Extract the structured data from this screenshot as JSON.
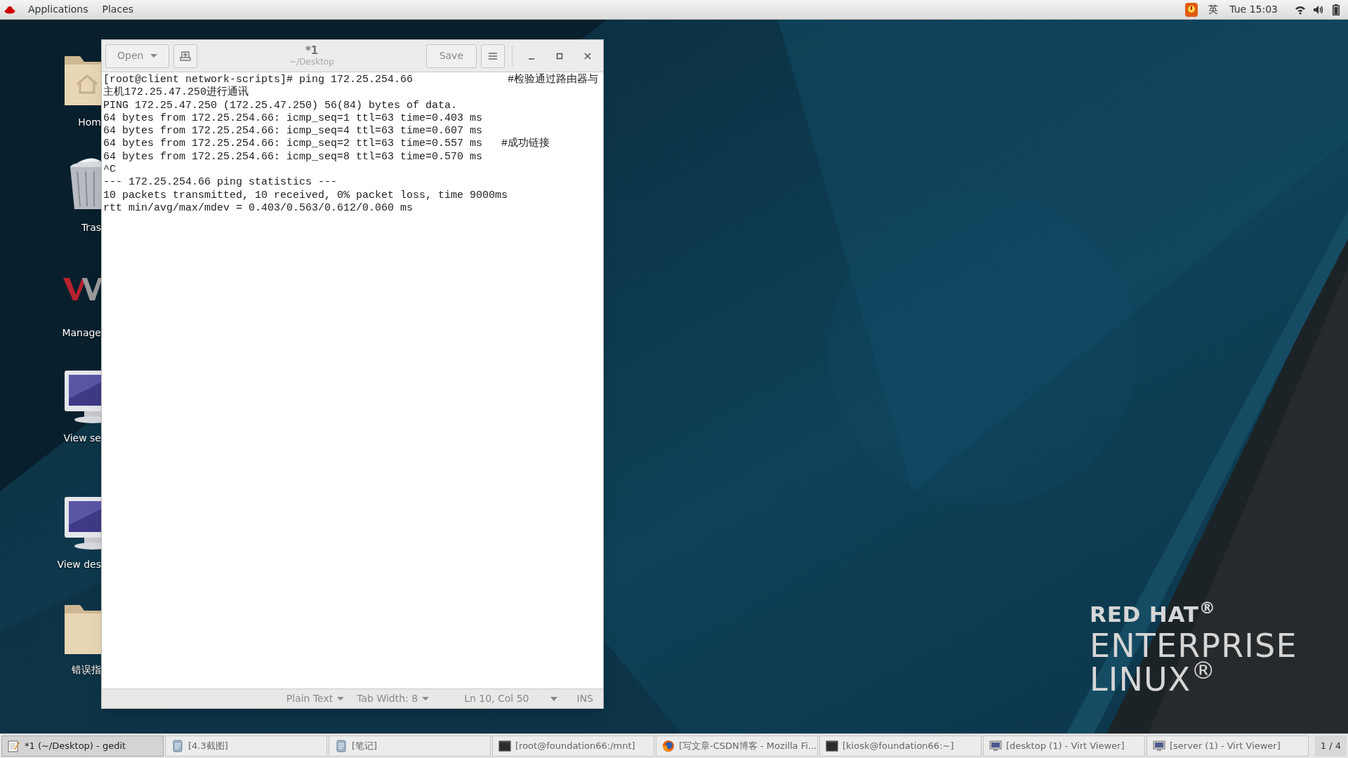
{
  "top_bar": {
    "menus": [
      "Applications",
      "Places"
    ],
    "input_method": "英",
    "clock": "Tue 15:03"
  },
  "desktop_icons": [
    {
      "label": "Hom",
      "kind": "home"
    },
    {
      "label": "Tras",
      "kind": "trash"
    },
    {
      "label": "Manage",
      "kind": "logo"
    },
    {
      "label": "View se",
      "kind": "monitor"
    },
    {
      "label": "View des",
      "kind": "monitor"
    },
    {
      "label": "错误指",
      "kind": "folder"
    }
  ],
  "wallpaper": {
    "logo": [
      "RED HAT$^{®}$",
      "ENTERPRISE",
      "LINUX$^{®}$"
    ]
  },
  "editor": {
    "title": "*1",
    "subtitle": "~/Desktop",
    "open_button": "Open",
    "save_button": "Save",
    "lines": [
      "[root@client network-scripts]# ping 172.25.254.66               #检验通过路由器与",
      "主机172.25.47.250进行通讯",
      "PING 172.25.47.250 (172.25.47.250) 56(84) bytes of data.",
      "64 bytes from 172.25.254.66: icmp_seq=1 ttl=63 time=0.403 ms",
      "64 bytes from 172.25.254.66: icmp_seq=4 ttl=63 time=0.607 ms",
      "64 bytes from 172.25.254.66: icmp_seq=2 ttl=63 time=0.557 ms   #成功链接",
      "64 bytes from 172.25.254.66: icmp_seq=8 ttl=63 time=0.570 ms",
      "^C",
      "--- 172.25.254.66 ping statistics ---",
      "10 packets transmitted, 10 received, 0% packet loss, time 9000ms",
      "rtt min/avg/max/mdev = 0.403/0.563/0.612/0.060 ms"
    ],
    "status": {
      "language": "Plain Text",
      "tab_width": "Tab Width: 8",
      "position": "Ln 10, Col 50",
      "mode": "INS"
    }
  },
  "taskbar": {
    "items": [
      {
        "label": "*1 (~/Desktop) - gedit",
        "kind": "editor",
        "selected": true
      },
      {
        "label": "[4.3截图]",
        "kind": "note",
        "selected": false
      },
      {
        "label": "[笔记]",
        "kind": "note",
        "selected": false
      },
      {
        "label": "[root@foundation66:/mnt]",
        "kind": "terminal",
        "selected": false
      },
      {
        "label": "[写文章-CSDN博客 - Mozilla Fi...",
        "kind": "browser",
        "selected": false
      },
      {
        "label": "[kiosk@foundation66:~]",
        "kind": "terminal",
        "selected": false
      },
      {
        "label": "[desktop (1) - Virt Viewer]",
        "kind": "viewer",
        "selected": false
      },
      {
        "label": "[server (1) - Virt Viewer]",
        "kind": "viewer",
        "selected": false
      }
    ],
    "workspace": "1 / 4"
  }
}
